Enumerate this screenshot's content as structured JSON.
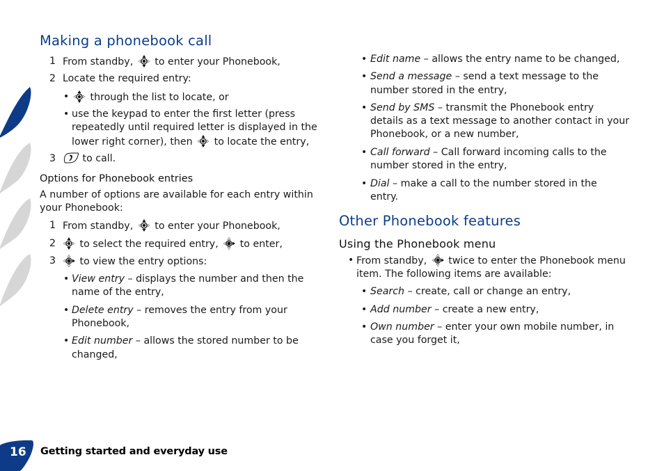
{
  "section_left": {
    "title": "Making a phonebook call",
    "steps": [
      {
        "num": "1",
        "before": "From standby,",
        "icon": "nav-key-updown-icon",
        "after": "to enter your Phonebook,"
      },
      {
        "num": "2",
        "text": "Locate the required entry:"
      },
      {
        "num": "3",
        "icon": "call-key-icon",
        "after": "to call."
      }
    ],
    "step2_bullets": [
      {
        "icon": "nav-key-updown-icon",
        "text": "through the list to locate, or"
      },
      {
        "lines": [
          "use the keypad to enter the first letter (press",
          "repeatedly until required letter is displayed in the"
        ],
        "last_before": "lower right corner), then",
        "icon": "nav-key-updown-icon",
        "last_after": "to locate the entry,"
      }
    ],
    "options": {
      "subtitle": "Options for Phonebook entries",
      "intro_lines": [
        "A number of options are available for each entry within",
        "your Phonebook:"
      ],
      "steps": [
        {
          "num": "1",
          "before": "From standby,",
          "icon": "nav-key-updown-icon",
          "after": "to enter your Phonebook,"
        },
        {
          "num": "2",
          "icon": "nav-key-updown-icon",
          "middle": "to select the required entry,",
          "icon2": "nav-key-right-icon",
          "after": "to enter,"
        },
        {
          "num": "3",
          "icon": "nav-key-right-icon",
          "after": "to view the entry options:"
        }
      ],
      "bullets": [
        {
          "term": "View entry",
          "desc": " – displays the number and then the",
          "cont": "name of the entry,"
        },
        {
          "term": "Delete entry",
          "desc": " – removes the entry from your",
          "cont": "Phonebook,"
        },
        {
          "term": "Edit number",
          "desc": " – allows the stored number to be",
          "cont": "changed,"
        }
      ]
    }
  },
  "section_right": {
    "bullets": [
      {
        "term": "Edit name",
        "desc": " – allows the entry name to be changed,"
      },
      {
        "term": "Send a message",
        "desc": " – send a text message to the",
        "cont": [
          "number stored in the entry,"
        ]
      },
      {
        "term": "Send by SMS",
        "desc": " – transmit the Phonebook entry",
        "cont": [
          "details as a text message to another contact in your",
          "Phonebook, or a new number,"
        ]
      },
      {
        "term": "Call forward",
        "desc": " – Call forward incoming calls to the",
        "cont": [
          "number stored in the entry,"
        ]
      },
      {
        "term": "Dial",
        "desc": " – make a call to the number stored in the",
        "cont": [
          "entry."
        ]
      }
    ],
    "title": "Other Phonebook features",
    "subtitle": "Using the Phonebook menu",
    "menu_intro": {
      "before": "From standby,",
      "icon": "nav-key-right-icon",
      "after": "twice to enter the Phonebook menu",
      "cont": "item. The following items are available:"
    },
    "menu_items": [
      {
        "term": "Search",
        "desc": " – create, call or change an entry,"
      },
      {
        "term": "Add number",
        "desc": " – create a new entry,"
      },
      {
        "term": "Own number",
        "desc": " – enter your own mobile number, in",
        "cont": "case you forget it,"
      }
    ]
  },
  "footer": {
    "page_number": "16",
    "chapter_title": "Getting started and everyday use"
  },
  "colors": {
    "heading_blue": "#0c3d8a",
    "deco_blue": "#0d3b88",
    "deco_grey": "#d6d6d6"
  }
}
